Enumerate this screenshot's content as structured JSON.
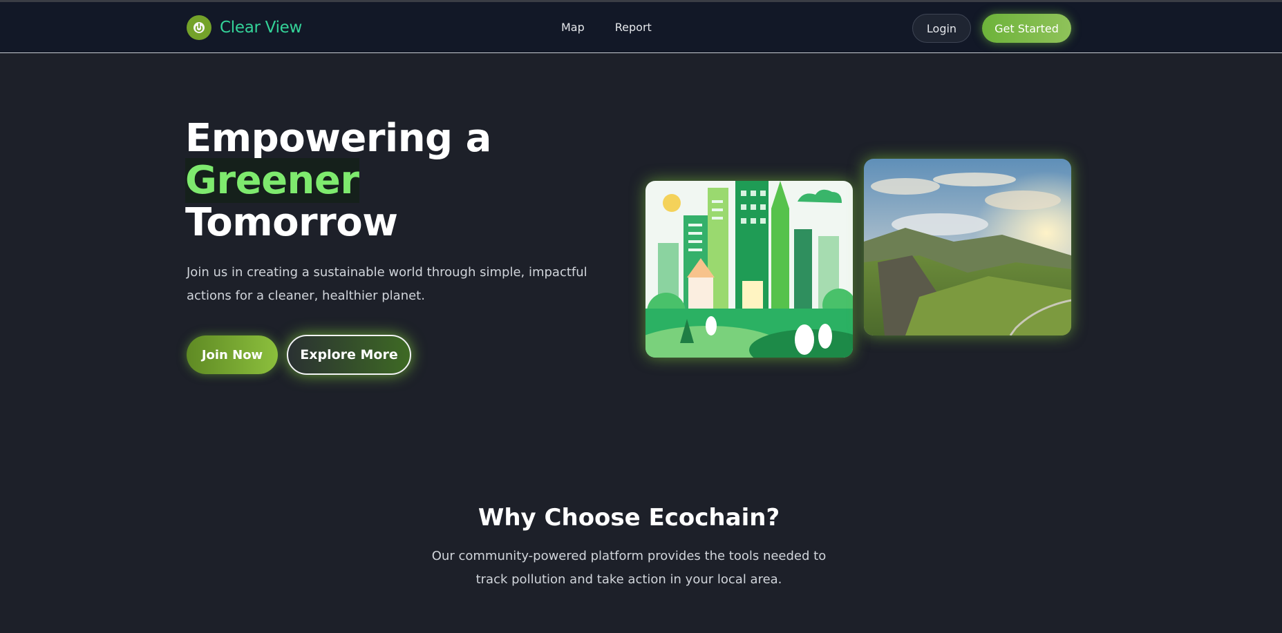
{
  "brand": {
    "name": "Clear View"
  },
  "nav": {
    "links": [
      "Map",
      "Report"
    ],
    "login_label": "Login",
    "get_started_label": "Get Started"
  },
  "hero": {
    "title_line1": "Empowering a",
    "title_highlight": "Greener",
    "title_line3": "Tomorrow",
    "description": "Join us in creating a sustainable world through simple, impactful actions for a cleaner, healthier planet.",
    "join_label": "Join Now",
    "explore_label": "Explore More"
  },
  "why": {
    "title": "Why Choose Ecochain?",
    "description": "Our community-powered platform provides the tools needed to track pollution and take action in your local area."
  },
  "colors": {
    "brand_green": "#34d399",
    "accent_green": "#7eea6e",
    "nav_bg": "#121827",
    "page_bg": "#1d2029"
  },
  "icons": {
    "logo": "power-icon"
  }
}
